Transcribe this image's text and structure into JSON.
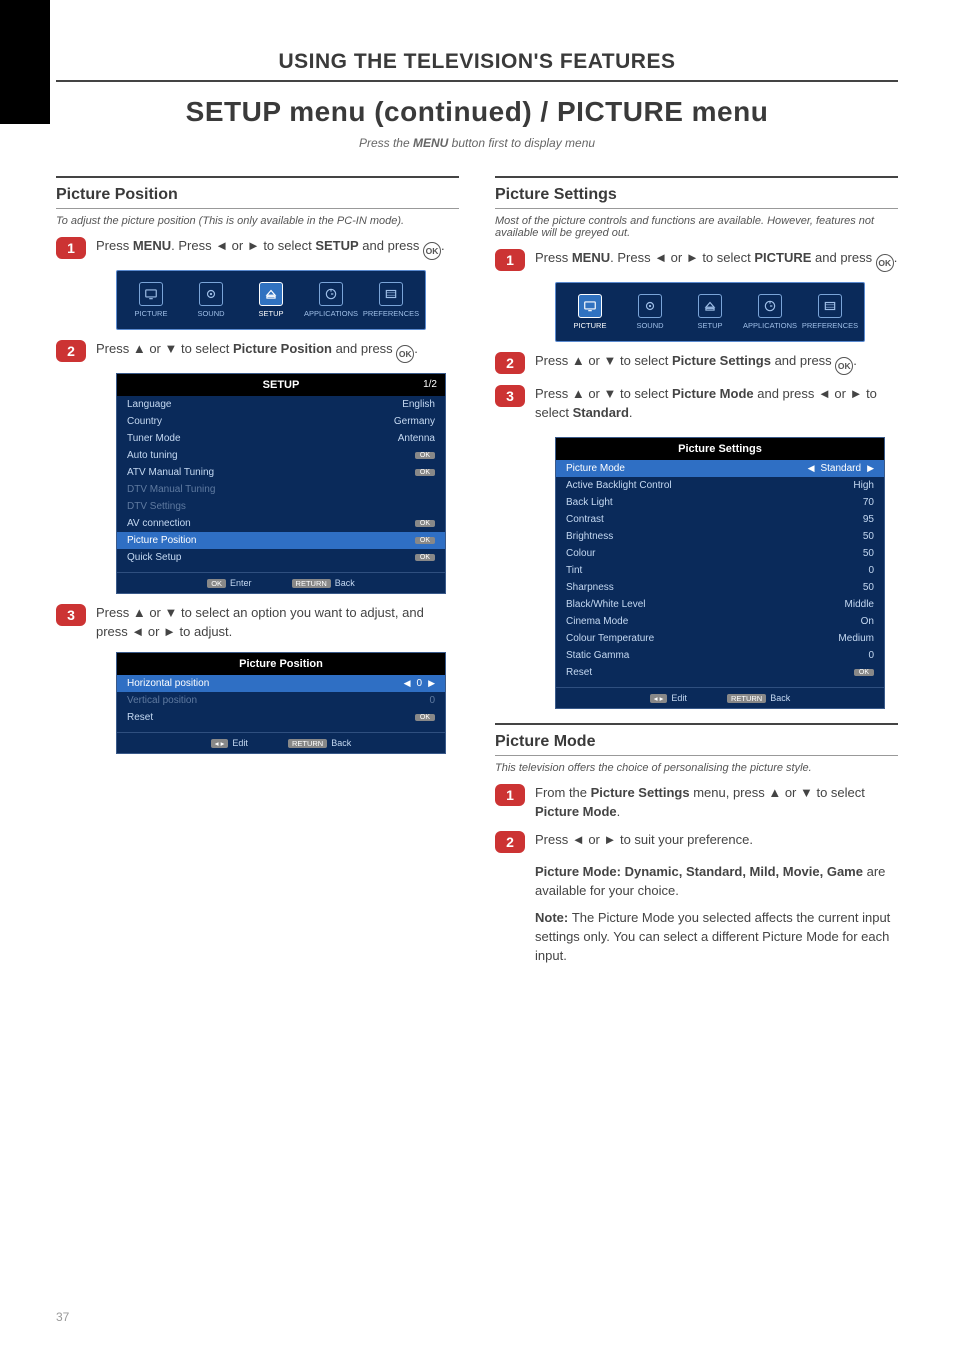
{
  "header": {
    "chapter": "USING THE TELEVISION'S FEATURES",
    "title": "SETUP menu (continued) / PICTURE menu",
    "subtitle_plain": "Press the ",
    "subtitle_key": "MENU",
    "subtitle_rest": " button first to display menu"
  },
  "left": {
    "section_title": "Picture Position",
    "section_desc": "To adjust the picture position (This is only available in the PC-IN mode).",
    "step1_a": "Press ",
    "step1_menu": "MENU",
    "step1_b": ". Press ◄ or ► to select ",
    "step1_setup": "SETUP",
    "step1_c": " and press ",
    "step1_d": ".",
    "step2_a": "Press ▲ or ▼ to select ",
    "step2_item": "Picture Position",
    "step2_b": " and press ",
    "step2_c": ".",
    "step3_a": "Press ▲ or ▼ to select an option you want to adjust, and press ◄ or ► to adjust.",
    "menubar": {
      "items": [
        {
          "name": "PICTURE"
        },
        {
          "name": "SOUND"
        },
        {
          "name": "SETUP",
          "active": true
        },
        {
          "name": "APPLICATIONS"
        },
        {
          "name": "PREFERENCES"
        }
      ]
    },
    "setup_panel": {
      "title": "SETUP",
      "page": "1/2",
      "rows": [
        {
          "label": "Language",
          "value": "English"
        },
        {
          "label": "Country",
          "value": "Germany"
        },
        {
          "label": "Tuner Mode",
          "value": "Antenna"
        },
        {
          "label": "Auto tuning",
          "value": "OK",
          "ok": true
        },
        {
          "label": "ATV Manual Tuning",
          "value": "OK",
          "ok": true
        },
        {
          "label": "DTV Manual Tuning",
          "value": "",
          "dim": true
        },
        {
          "label": "DTV Settings",
          "value": "",
          "dim": true
        },
        {
          "label": "AV connection",
          "value": "OK",
          "ok": true
        },
        {
          "label": "Picture Position",
          "value": "OK",
          "ok": true,
          "sel": true
        },
        {
          "label": "Quick Setup",
          "value": "OK",
          "ok": true
        }
      ],
      "foot_enter_key": "OK",
      "foot_enter": "Enter",
      "foot_back_key": "RETURN",
      "foot_back": "Back"
    },
    "pp_panel": {
      "title": "Picture Position",
      "rows": [
        {
          "label": "Horizontal position",
          "value": "0",
          "sel": true,
          "arrows": true
        },
        {
          "label": "Vertical position",
          "value": "0",
          "dim": true
        },
        {
          "label": "Reset",
          "value": "OK",
          "ok": true
        }
      ],
      "foot_edit_key": "◂ ▸",
      "foot_edit": "Edit",
      "foot_back_key": "RETURN",
      "foot_back": "Back"
    }
  },
  "right": {
    "section_title": "Picture Settings",
    "section_desc": "Most of the picture controls and functions are available. However, features not available will be greyed out.",
    "step1_a": "Press ",
    "step1_menu": "MENU",
    "step1_b": ". Press ◄ or ► to select ",
    "step1_pic": "PICTURE",
    "step1_c": " and press ",
    "step1_d": ".",
    "step2_a": "Press ▲ or ▼ to select ",
    "step2_item": "Picture Settings",
    "step2_b": " and press ",
    "step2_c": ".",
    "step3_a": "Press ▲ or ▼ to select ",
    "step3_item": "Picture Mode",
    "step3_b": " and press ◄ or ► to select ",
    "step3_item2": "Standard",
    "step3_c": ".",
    "menubar": {
      "items": [
        {
          "name": "PICTURE",
          "active": true
        },
        {
          "name": "SOUND"
        },
        {
          "name": "SETUP"
        },
        {
          "name": "APPLICATIONS"
        },
        {
          "name": "PREFERENCES"
        }
      ]
    },
    "ps_panel": {
      "title": "Picture Settings",
      "rows": [
        {
          "label": "Picture Mode",
          "value": "Standard",
          "sel": true,
          "arrows": true
        },
        {
          "label": "Active Backlight Control",
          "value": "High"
        },
        {
          "label": "Back Light",
          "value": "70"
        },
        {
          "label": "Contrast",
          "value": "95"
        },
        {
          "label": "Brightness",
          "value": "50"
        },
        {
          "label": "Colour",
          "value": "50"
        },
        {
          "label": "Tint",
          "value": "0"
        },
        {
          "label": "Sharpness",
          "value": "50"
        },
        {
          "label": "Black/White Level",
          "value": "Middle"
        },
        {
          "label": "Cinema Mode",
          "value": "On"
        },
        {
          "label": "Colour Temperature",
          "value": "Medium"
        },
        {
          "label": "Static Gamma",
          "value": "0"
        },
        {
          "label": "Reset",
          "value": "OK",
          "ok": true
        }
      ],
      "foot_edit_key": "◂ ▸",
      "foot_edit": "Edit",
      "foot_back_key": "RETURN",
      "foot_back": "Back"
    },
    "section2_title": "Picture Mode",
    "section2_desc": "This television offers the choice of personalising the picture style.",
    "section2_step1_a": "From the ",
    "section2_step1_ps": "Picture Settings",
    "section2_step1_b": " menu, press ▲ or ▼ to select ",
    "section2_step1_pm": "Picture Mode",
    "section2_step1_c": ".",
    "section2_step2": "Press ◄ or ► to suit your preference.",
    "pm_options_lead": "Picture Mode: ",
    "pm_options_list": "Dynamic, Standard, Mild, Movie, Game",
    "pm_options_tail": " are available for your choice.",
    "pm_note_lead": "Note: ",
    "pm_note_body": "The Picture Mode you selected affects the current input settings only. You can select a different Picture Mode for each input."
  },
  "chart_data": {
    "type": "table",
    "tables": [
      {
        "name": "SETUP panel",
        "columns": [
          "Option",
          "Value"
        ],
        "rows": [
          [
            "Language",
            "English"
          ],
          [
            "Country",
            "Germany"
          ],
          [
            "Tuner Mode",
            "Antenna"
          ],
          [
            "Auto tuning",
            "OK"
          ],
          [
            "ATV Manual Tuning",
            "OK"
          ],
          [
            "DTV Manual Tuning",
            ""
          ],
          [
            "DTV Settings",
            ""
          ],
          [
            "AV connection",
            "OK"
          ],
          [
            "Picture Position",
            "OK"
          ],
          [
            "Quick Setup",
            "OK"
          ]
        ]
      },
      {
        "name": "Picture Position panel",
        "columns": [
          "Option",
          "Value"
        ],
        "rows": [
          [
            "Horizontal position",
            "0"
          ],
          [
            "Vertical position",
            "0"
          ],
          [
            "Reset",
            "OK"
          ]
        ]
      },
      {
        "name": "Picture Settings panel",
        "columns": [
          "Option",
          "Value"
        ],
        "rows": [
          [
            "Picture Mode",
            "Standard"
          ],
          [
            "Active Backlight Control",
            "High"
          ],
          [
            "Back Light",
            "70"
          ],
          [
            "Contrast",
            "95"
          ],
          [
            "Brightness",
            "50"
          ],
          [
            "Colour",
            "50"
          ],
          [
            "Tint",
            "0"
          ],
          [
            "Sharpness",
            "50"
          ],
          [
            "Black/White Level",
            "Middle"
          ],
          [
            "Cinema Mode",
            "On"
          ],
          [
            "Colour Temperature",
            "Medium"
          ],
          [
            "Static Gamma",
            "0"
          ],
          [
            "Reset",
            "OK"
          ]
        ]
      }
    ]
  },
  "page_number": "37"
}
